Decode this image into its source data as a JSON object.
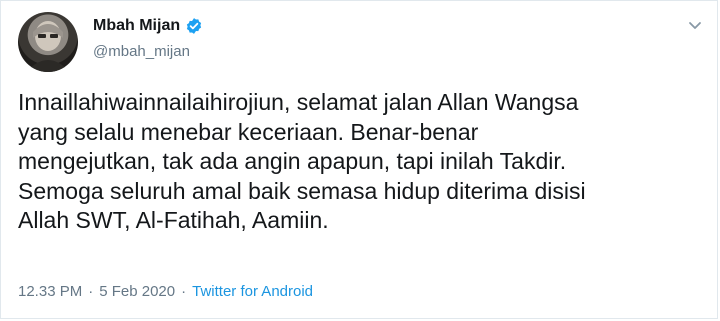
{
  "user": {
    "display_name": "Mbah Mijan",
    "handle": "@mbah_mijan",
    "verified": true
  },
  "tweet": {
    "lines": [
      "Innaillahiwainnailaihirojiun, selamat jalan Allan Wangsa",
      "yang selalu menebar keceriaan. Benar-benar",
      "mengejutkan, tak ada angin apapun, tapi inilah Takdir.",
      "Semoga seluruh amal baik semasa hidup diterima disisi",
      "Allah SWT, Al-Fatihah, Aamiin."
    ]
  },
  "meta": {
    "time": "12.33 PM",
    "separator": "·",
    "date": "5 Feb 2020",
    "source": "Twitter for Android"
  },
  "colors": {
    "verified": "#1da1f2",
    "link": "#1b95e0",
    "muted": "#657786",
    "text": "#14171a"
  },
  "icons": {
    "verified": "verified-badge-icon",
    "menu": "chevron-down-icon"
  }
}
